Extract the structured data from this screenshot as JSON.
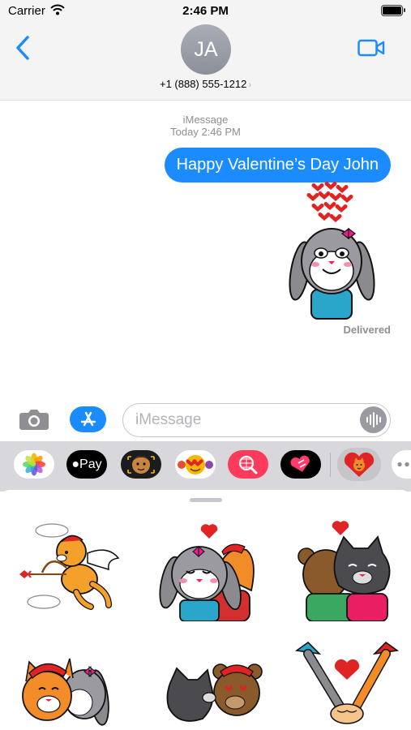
{
  "status_bar": {
    "carrier": "Carrier",
    "time": "2:46 PM"
  },
  "header": {
    "avatar_initials": "JA",
    "contact": "+1 (888) 555-1212",
    "chevron": "›"
  },
  "conversation": {
    "service": "iMessage",
    "timestamp": "Today 2:46 PM",
    "messages": [
      {
        "type": "text",
        "text": "Happy Valentine’s Day John",
        "color": "#1a8cff"
      },
      {
        "type": "sticker",
        "name": "bunny-with-hearts-sticker"
      }
    ],
    "delivery_status": "Delivered"
  },
  "composer": {
    "placeholder": "iMessage"
  },
  "app_drawer": {
    "apps": [
      {
        "name": "photos-icon"
      },
      {
        "name": "apple-pay-icon",
        "label": "Pay"
      },
      {
        "name": "memoji-icon"
      },
      {
        "name": "animoji-icon"
      },
      {
        "name": "web-search-icon"
      },
      {
        "name": "heart-stickers-icon"
      },
      {
        "name": "valentine-stickers-app-icon",
        "selected": true
      },
      {
        "name": "more-apps-icon"
      }
    ]
  },
  "sticker_panel": {
    "stickers": [
      {
        "name": "cupid-cat-sticker"
      },
      {
        "name": "bunny-cat-hug-sticker"
      },
      {
        "name": "bear-cat-hug-sticker"
      },
      {
        "name": "cat-bunny-sticker"
      },
      {
        "name": "cat-bear-kiss-sticker"
      },
      {
        "name": "holding-hands-sticker"
      }
    ]
  },
  "colors": {
    "accent": "#1a8cff",
    "header_bg": "#f4f4f5",
    "drawer_bg": "#d8d8dc"
  }
}
